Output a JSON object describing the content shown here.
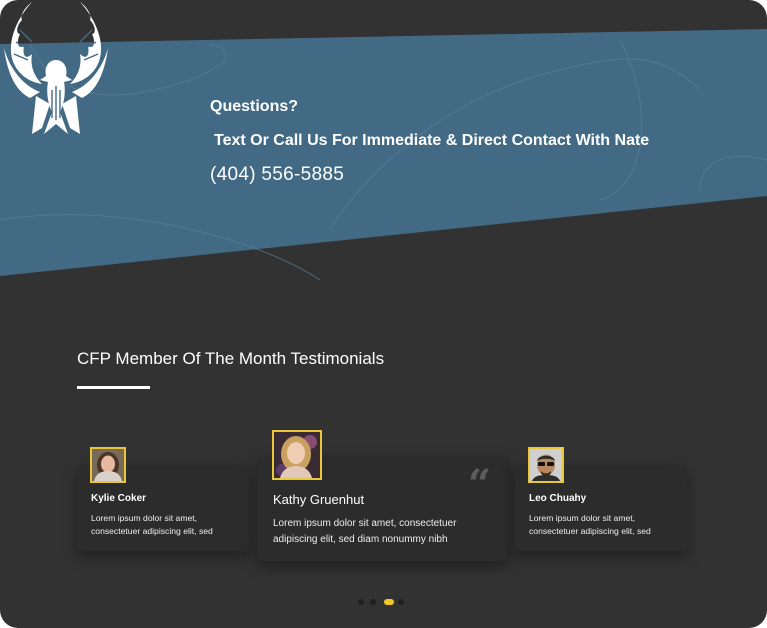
{
  "contact": {
    "title": "Questions?",
    "text": "Text Or Call Us For Immediate & Direct Contact With Nate",
    "phone": "(404) 556-5885"
  },
  "testimonials": {
    "heading": "CFP Member Of The Month Testimonials",
    "items": [
      {
        "name": "Kylie Coker",
        "text": "Lorem ipsum dolor sit amet, consectetuer adipiscing elit, sed"
      },
      {
        "name": "Kathy Gruenhut",
        "text": "Lorem ipsum dolor sit amet, consectetuer adipiscing elit, sed diam nonummy nibh"
      },
      {
        "name": "Leo Chuahy",
        "text": "Lorem ipsum dolor sit amet, consectetuer adipiscing elit, sed"
      }
    ],
    "active_slide": 3,
    "slide_count": 4
  },
  "colors": {
    "background": "#323232",
    "banner": "#426a84",
    "accent": "#f3c526",
    "avatar_border": "#e8c83a"
  },
  "icons": {
    "logo": "phoenix-logo-icon",
    "quote": "quote-icon"
  }
}
